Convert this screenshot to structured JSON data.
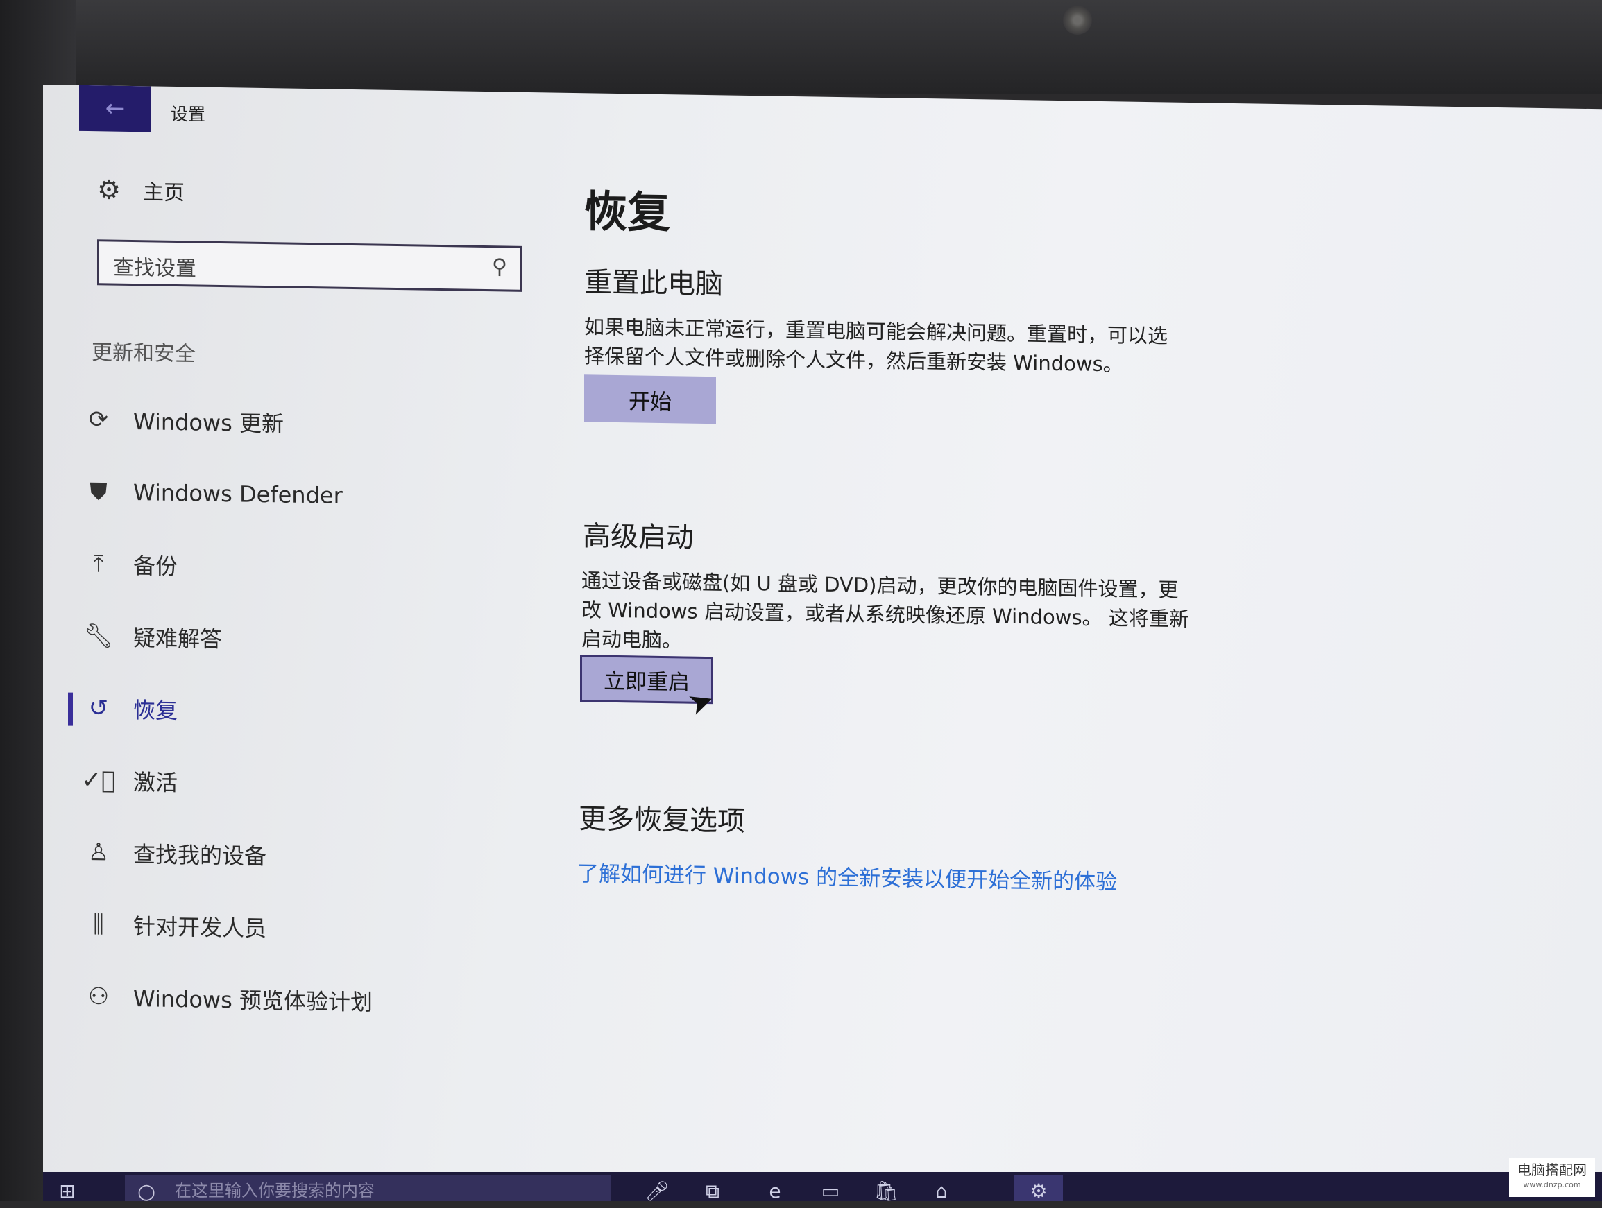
{
  "window": {
    "title": "设置",
    "back_icon": "arrow-left-icon"
  },
  "sidebar": {
    "home_label": "主页",
    "search_placeholder": "查找设置",
    "section_label": "更新和安全",
    "items": [
      {
        "label": "Windows 更新",
        "icon": "refresh-icon"
      },
      {
        "label": "Windows Defender",
        "icon": "shield-icon"
      },
      {
        "label": "备份",
        "icon": "upload-arrow-icon"
      },
      {
        "label": "疑难解答",
        "icon": "wrench-icon"
      },
      {
        "label": "恢复",
        "icon": "history-icon",
        "active": true
      },
      {
        "label": "激活",
        "icon": "check-circle-icon"
      },
      {
        "label": "查找我的设备",
        "icon": "person-location-icon"
      },
      {
        "label": "针对开发人员",
        "icon": "developer-tools-icon"
      },
      {
        "label": "Windows 预览体验计划",
        "icon": "insider-icon"
      }
    ]
  },
  "main": {
    "title": "恢复",
    "reset": {
      "heading": "重置此电脑",
      "desc_line1": "如果电脑未正常运行，重置电脑可能会解决问题。重置时，可以选",
      "desc_line2": "择保留个人文件或删除个人文件，然后重新安装 Windows。",
      "button": "开始"
    },
    "advanced": {
      "heading": "高级启动",
      "desc_line1": "通过设备或磁盘(如 U 盘或 DVD)启动，更改你的电脑固件设置，更",
      "desc_line2": "改 Windows 启动设置，或者从系统映像还原 Windows。 这将重新",
      "desc_line3": "启动电脑。",
      "button": "立即重启"
    },
    "more": {
      "heading": "更多恢复选项",
      "link": "了解如何进行 Windows 的全新安装以便开始全新的体验"
    }
  },
  "taskbar": {
    "search_placeholder": "在这里输入你要搜索的内容"
  },
  "watermark": {
    "line1": "电脑搭配网",
    "line2": "www.dnzp.com"
  }
}
